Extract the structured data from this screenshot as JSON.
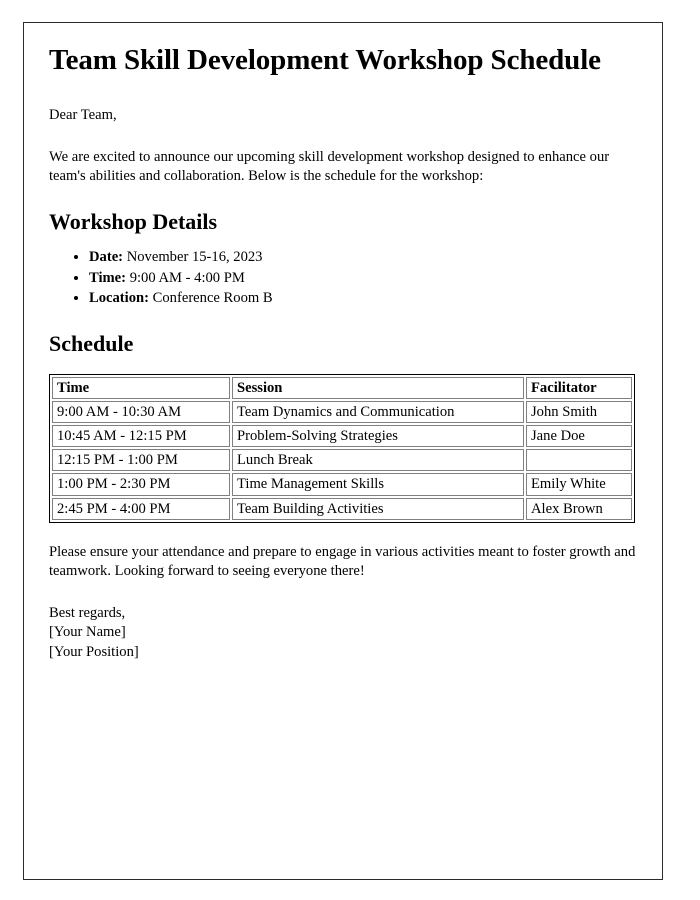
{
  "document": {
    "title": "Team Skill Development Workshop Schedule",
    "salutation": "Dear Team,",
    "intro_paragraph": "We are excited to announce our upcoming skill development workshop designed to enhance our team's abilities and collaboration. Below is the schedule for the workshop:",
    "closing_paragraph": "Please ensure your attendance and prepare to engage in various activities meant to foster growth and teamwork. Looking forward to seeing everyone there!",
    "signature": {
      "closing": "Best regards,",
      "name": "[Your Name]",
      "position": "[Your Position]"
    }
  },
  "workshop_details": {
    "heading": "Workshop Details",
    "items": [
      {
        "label": "Date:",
        "value": "November 15-16, 2023"
      },
      {
        "label": "Time:",
        "value": "9:00 AM - 4:00 PM"
      },
      {
        "label": "Location:",
        "value": "Conference Room B"
      }
    ]
  },
  "schedule": {
    "heading": "Schedule",
    "columns": [
      "Time",
      "Session",
      "Facilitator"
    ],
    "rows": [
      {
        "time": "9:00 AM - 10:30 AM",
        "session": "Team Dynamics and Communication",
        "facilitator": "John Smith"
      },
      {
        "time": "10:45 AM - 12:15 PM",
        "session": "Problem-Solving Strategies",
        "facilitator": "Jane Doe"
      },
      {
        "time": "12:15 PM - 1:00 PM",
        "session": "Lunch Break",
        "facilitator": ""
      },
      {
        "time": "1:00 PM - 2:30 PM",
        "session": "Time Management Skills",
        "facilitator": "Emily White"
      },
      {
        "time": "2:45 PM - 4:00 PM",
        "session": "Team Building Activities",
        "facilitator": "Alex Brown"
      }
    ]
  },
  "theme": {
    "page_background": "#ffffff",
    "text_color": "#000000",
    "frame_border_color": "#2b2b2b",
    "table_outer_border_color": "#000000",
    "table_cell_border_color": "#808080"
  }
}
